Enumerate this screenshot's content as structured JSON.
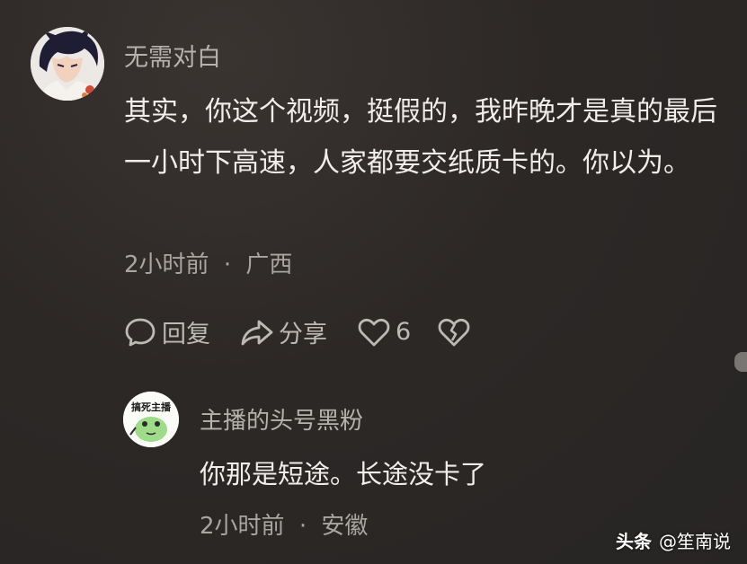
{
  "comment": {
    "username": "无需对白",
    "text": "其实，你这个视频，挺假的，我昨晚才是真的最后一小时下高速，人家都要交纸质卡的。你以为。",
    "time": "2小时前",
    "separator": "·",
    "location": "广西",
    "actions": {
      "reply_label": "回复",
      "share_label": "分享",
      "like_count": "6"
    },
    "icons": {
      "reply": "speech-bubble-icon",
      "share": "share-arrow-icon",
      "like": "heart-icon",
      "dislike": "broken-heart-icon"
    }
  },
  "reply": {
    "username": "主播的头号黑粉",
    "avatar_text": "搞死主播",
    "text": "你那是短途。长途没卡了",
    "time": "2小时前",
    "separator": "·",
    "location": "安徽"
  },
  "watermark": {
    "brand": "头条",
    "handle": "@笙南说"
  },
  "colors": {
    "background": "#2c2826",
    "text": "#f0edea",
    "secondary": "#b6b2ae"
  }
}
